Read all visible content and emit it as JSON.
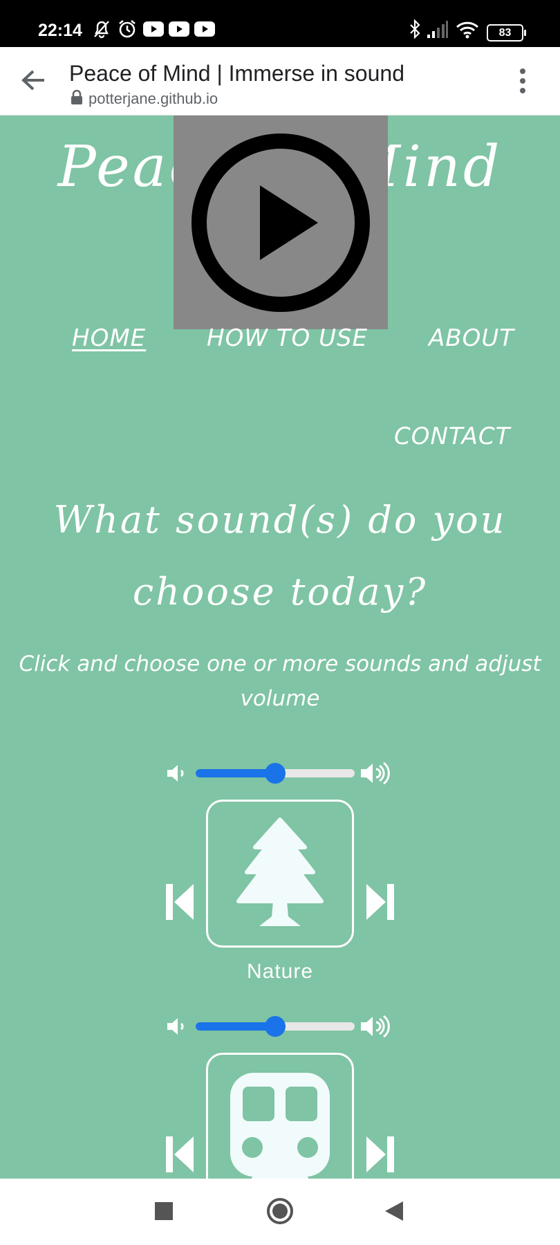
{
  "status_bar": {
    "time": "22:14",
    "battery": "83",
    "icons": [
      "bell-off-icon",
      "alarm-icon",
      "youtube-icon",
      "youtube-icon",
      "youtube-icon",
      "bluetooth-icon",
      "signal-icon",
      "wifi-icon",
      "battery-icon"
    ]
  },
  "browser": {
    "page_title": "Peace of Mind | Immerse in sound",
    "url": "potterjane.github.io",
    "back_icon": "back-arrow-icon",
    "menu_icon": "more-vert-icon"
  },
  "site": {
    "logo": "Peace of Mind",
    "nav": {
      "home": "HOME",
      "how_to_use": "HOW TO USE",
      "about": "ABOUT",
      "contact": "CONTACT"
    },
    "heading": "What sound(s) do you choose today?",
    "subtitle": "Click and choose one or more sounds and adjust volume",
    "sounds": [
      {
        "label": "Nature",
        "icon": "tree-icon",
        "volume": 0.5
      },
      {
        "label": "",
        "icon": "train-icon",
        "volume": 0.5
      }
    ]
  },
  "colors": {
    "background": "#7fc4a4",
    "slider_accent": "#1a73e8",
    "white": "#ffffff"
  }
}
